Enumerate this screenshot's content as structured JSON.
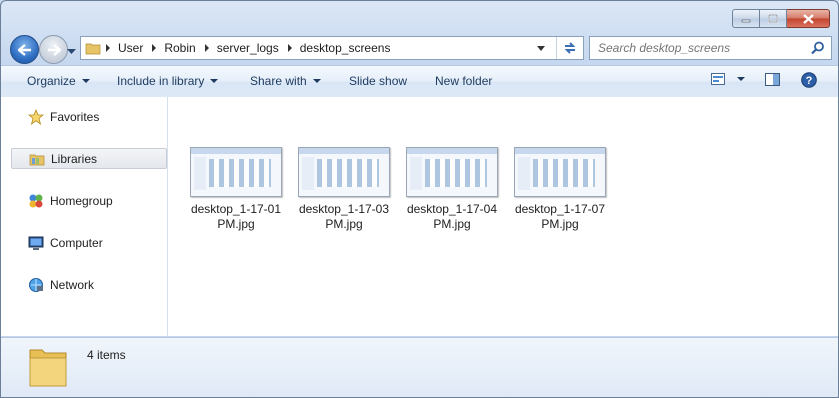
{
  "window": {
    "controls": [
      "minimize-icon",
      "maximize-icon",
      "close-icon"
    ]
  },
  "address": {
    "crumbs": [
      "User",
      "Robin",
      "server_logs",
      "desktop_screens"
    ]
  },
  "search": {
    "placeholder": "Search desktop_screens"
  },
  "toolbar": {
    "organize": "Organize",
    "include_in_library": "Include in library",
    "share_with": "Share with",
    "slide_show": "Slide show",
    "new_folder": "New folder"
  },
  "nav": {
    "items": [
      {
        "label": "Favorites",
        "icon": "star-icon"
      },
      {
        "label": "Libraries",
        "icon": "libraries-icon",
        "selected": true
      },
      {
        "label": "Homegroup",
        "icon": "homegroup-icon"
      },
      {
        "label": "Computer",
        "icon": "computer-icon"
      },
      {
        "label": "Network",
        "icon": "network-icon"
      }
    ]
  },
  "files": [
    {
      "line1": "desktop_1-17-01",
      "line2": "PM.jpg"
    },
    {
      "line1": "desktop_1-17-03",
      "line2": "PM.jpg"
    },
    {
      "line1": "desktop_1-17-04",
      "line2": "PM.jpg"
    },
    {
      "line1": "desktop_1-17-07",
      "line2": "PM.jpg"
    }
  ],
  "details": {
    "item_count": "4 items"
  },
  "colors": {
    "accent": "#2f6fc3",
    "chrome": "#c6d8ef",
    "close": "#c2442d"
  }
}
